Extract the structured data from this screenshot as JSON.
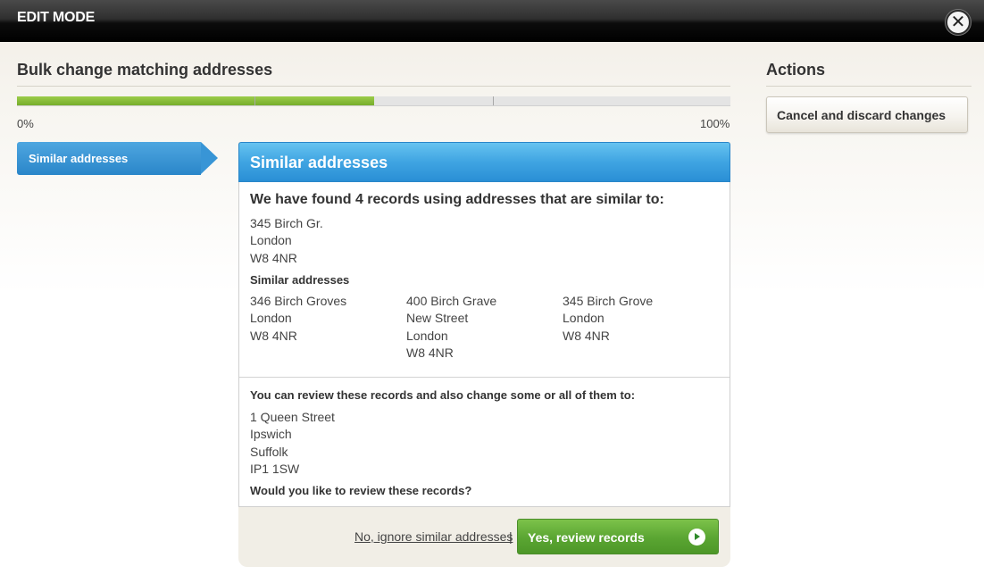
{
  "header": {
    "title": "EDIT MODE",
    "close_symbol": "✕"
  },
  "page": {
    "title": "Bulk change matching addresses"
  },
  "progress": {
    "fraction": 0.5,
    "segments": 3,
    "start_label": "0%",
    "end_label": "100%",
    "fill_color": "#86bb38"
  },
  "steps": [
    {
      "label": "Similar addresses",
      "active": true
    }
  ],
  "panel": {
    "title": "Similar addresses",
    "found_heading": "We have found 4 records using addresses that are similar to:",
    "original_address": [
      "345 Birch Gr.",
      "London",
      "W8 4NR"
    ],
    "similar_heading": "Similar addresses",
    "similar_addresses": [
      [
        "346 Birch Groves",
        "London",
        "W8 4NR"
      ],
      [
        "400 Birch Grave",
        "New Street",
        "London",
        "W8 4NR"
      ],
      [
        "345 Birch Grove",
        "London",
        "W8 4NR"
      ]
    ],
    "review_heading": "You can review these records and also change some or all of them to:",
    "new_address": [
      "1 Queen Street",
      "Ipswich",
      "Suffolk",
      "IP1 1SW"
    ],
    "question": "Would you like to review these records?"
  },
  "footer": {
    "ignore_link": "No, ignore similar addresses",
    "separator": "|",
    "confirm_button": "Yes, review records"
  },
  "actions": {
    "title": "Actions",
    "cancel_button": "Cancel and discard changes"
  },
  "colors": {
    "accent_blue": "#3fa4e2",
    "confirm_green": "#5aa532"
  },
  "icons": {
    "close": "close-icon",
    "confirm_arrow": "play-arrow-icon"
  }
}
